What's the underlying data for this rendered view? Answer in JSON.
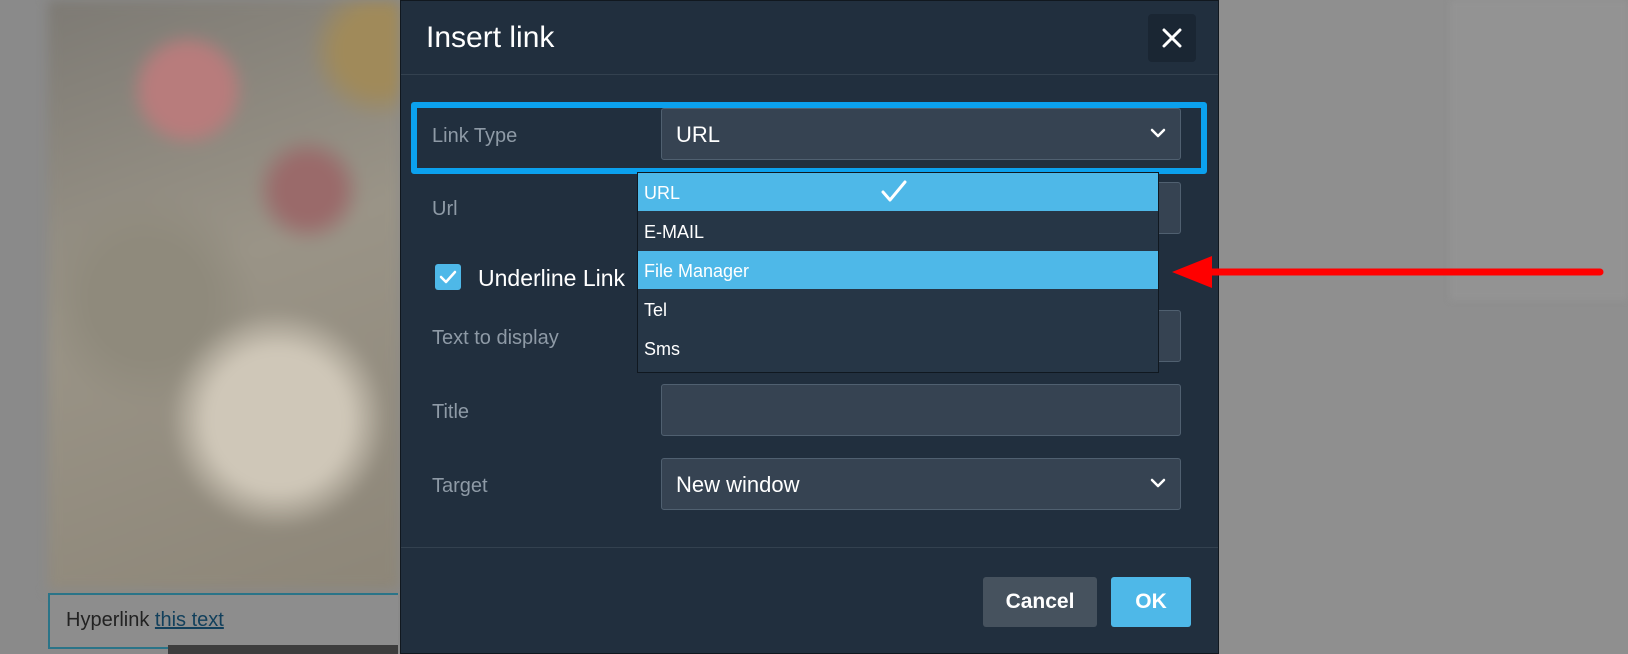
{
  "background": {
    "hyperlink_prefix": "Hyperlink",
    "hyperlink_text": "this text"
  },
  "dialog": {
    "title": "Insert link",
    "close_icon": "close-icon",
    "link_type": {
      "label": "Link Type",
      "value": "URL"
    },
    "url": {
      "label": "Url",
      "value": ""
    },
    "underline": {
      "label": "Underline Link",
      "checked": true
    },
    "text_to_display": {
      "label": "Text to display",
      "value": ""
    },
    "title_field": {
      "label": "Title",
      "value": ""
    },
    "target": {
      "label": "Target",
      "value": "New window"
    },
    "cancel_label": "Cancel",
    "ok_label": "OK"
  },
  "dropdown": {
    "options": [
      "URL",
      "E-MAIL",
      "File Manager",
      "Tel",
      "Sms"
    ],
    "selected": "URL",
    "hovered": "File Manager"
  },
  "colors": {
    "dialog_bg": "#212f3e",
    "field_bg": "#364352",
    "accent": "#4eb8e8",
    "highlight_frame": "#0ba1ee",
    "annotation_arrow": "#ff0000"
  }
}
